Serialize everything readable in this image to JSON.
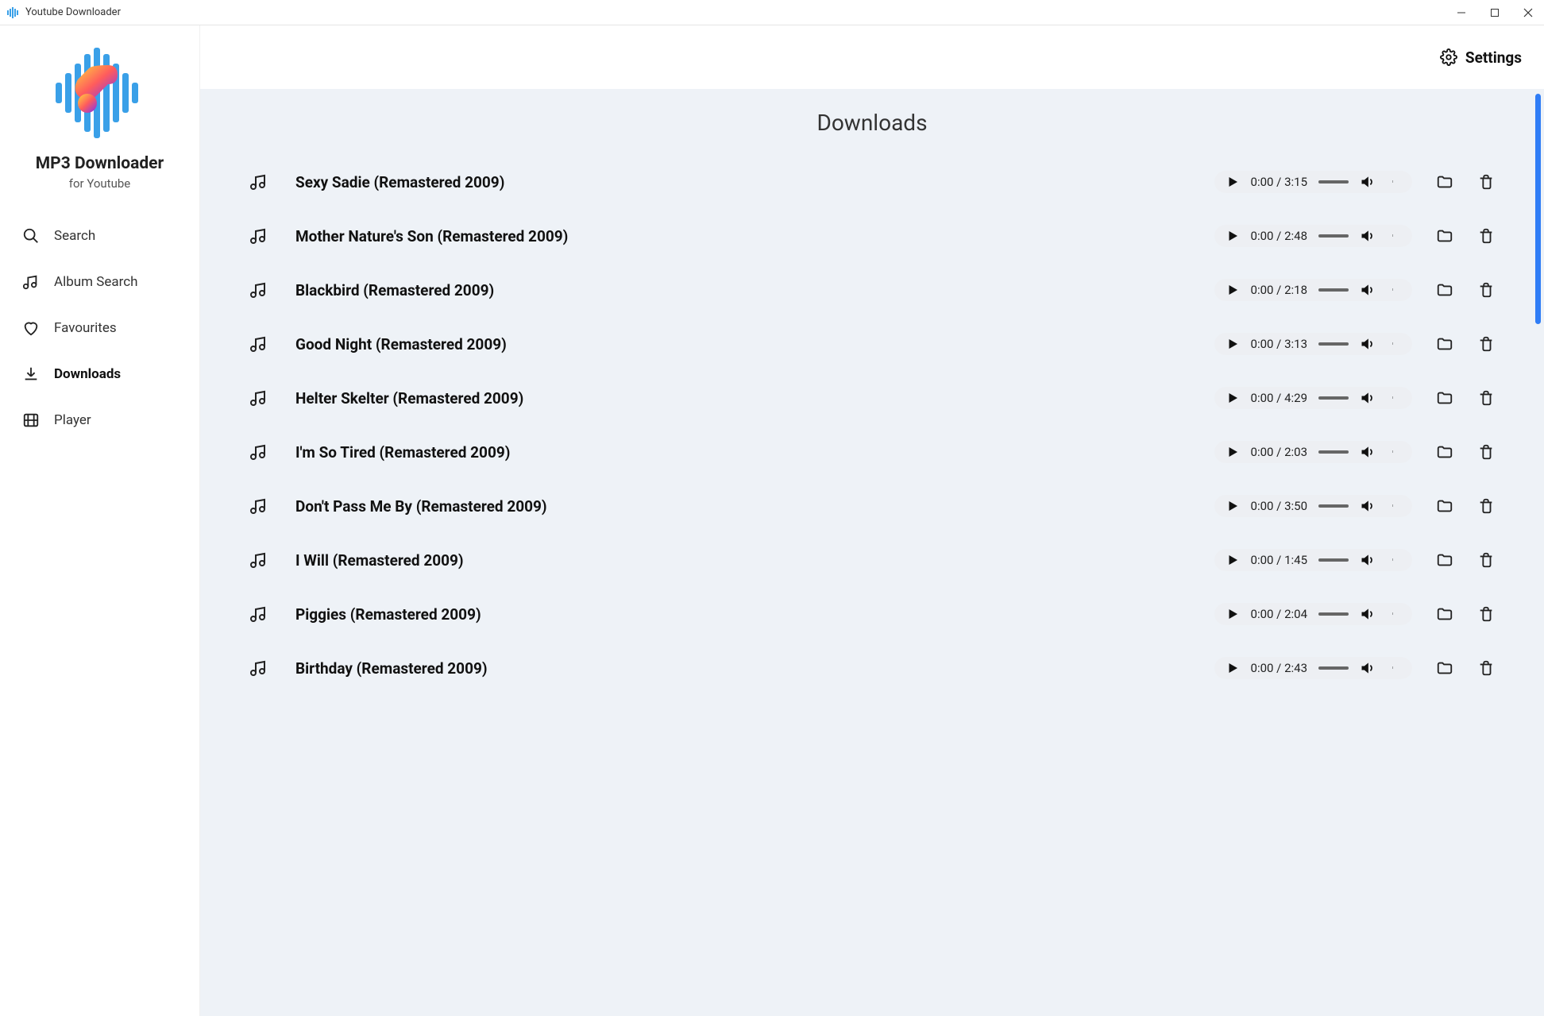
{
  "window": {
    "title": "Youtube Downloader"
  },
  "app": {
    "title": "MP3 Downloader",
    "subtitle": "for Youtube"
  },
  "nav": {
    "items": [
      {
        "label": "Search",
        "icon": "search"
      },
      {
        "label": "Album Search",
        "icon": "music"
      },
      {
        "label": "Favourites",
        "icon": "heart"
      },
      {
        "label": "Downloads",
        "icon": "download",
        "active": true
      },
      {
        "label": "Player",
        "icon": "film"
      }
    ]
  },
  "topbar": {
    "settings_label": "Settings"
  },
  "page": {
    "title": "Downloads"
  },
  "downloads": [
    {
      "title": "Sexy Sadie (Remastered 2009)",
      "current": "0:00",
      "duration": "3:15"
    },
    {
      "title": "Mother Nature's Son (Remastered 2009)",
      "current": "0:00",
      "duration": "2:48"
    },
    {
      "title": "Blackbird (Remastered 2009)",
      "current": "0:00",
      "duration": "2:18"
    },
    {
      "title": "Good Night (Remastered 2009)",
      "current": "0:00",
      "duration": "3:13"
    },
    {
      "title": "Helter Skelter (Remastered 2009)",
      "current": "0:00",
      "duration": "4:29"
    },
    {
      "title": "I'm So Tired (Remastered 2009)",
      "current": "0:00",
      "duration": "2:03"
    },
    {
      "title": "Don't Pass Me By (Remastered 2009)",
      "current": "0:00",
      "duration": "3:50"
    },
    {
      "title": "I Will (Remastered 2009)",
      "current": "0:00",
      "duration": "1:45"
    },
    {
      "title": "Piggies (Remastered 2009)",
      "current": "0:00",
      "duration": "2:04"
    },
    {
      "title": "Birthday (Remastered 2009)",
      "current": "0:00",
      "duration": "2:43"
    }
  ]
}
